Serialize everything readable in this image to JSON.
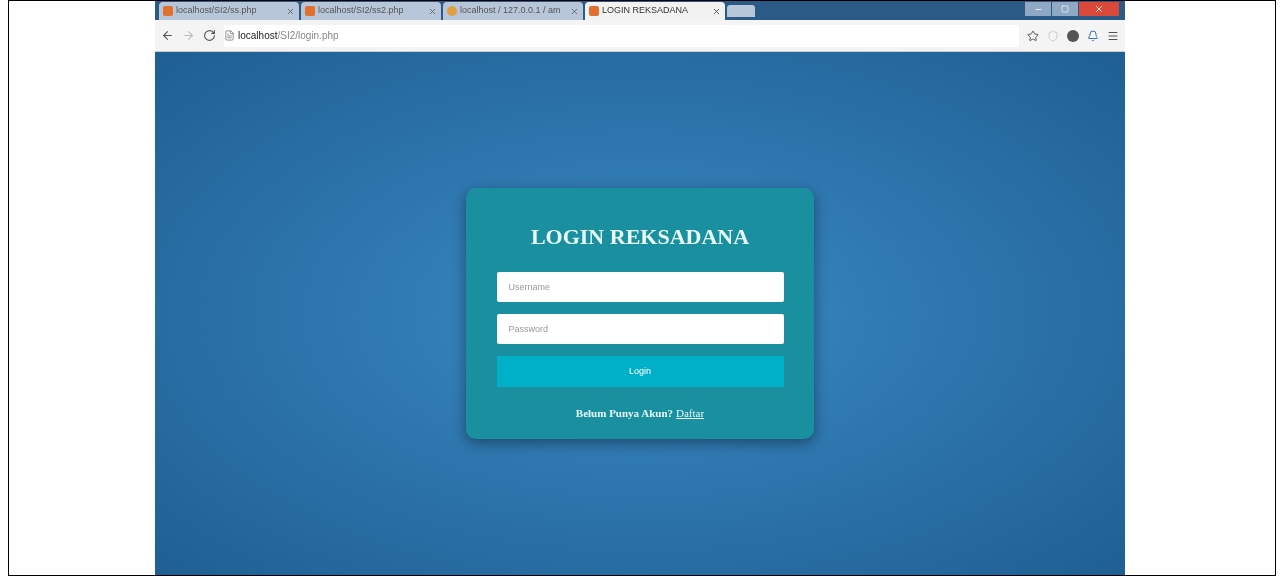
{
  "browser": {
    "tabs": [
      {
        "title": "localhost/SI2/ss.php",
        "selected": false,
        "kind": "page"
      },
      {
        "title": "localhost/SI2/ss2.php",
        "selected": false,
        "kind": "page"
      },
      {
        "title": "localhost / 127.0.0.1 / am",
        "selected": false,
        "kind": "db"
      },
      {
        "title": "LOGIN REKSADANA",
        "selected": true,
        "kind": "page"
      }
    ],
    "address": {
      "host": "localhost",
      "path": "/SI2/login.php"
    }
  },
  "login": {
    "title": "LOGIN REKSADANA",
    "username": {
      "placeholder": "Username"
    },
    "password": {
      "placeholder": "Password"
    },
    "button": "Login",
    "register_prompt": "Belum Punya Akun?",
    "register_link": "Daftar"
  }
}
